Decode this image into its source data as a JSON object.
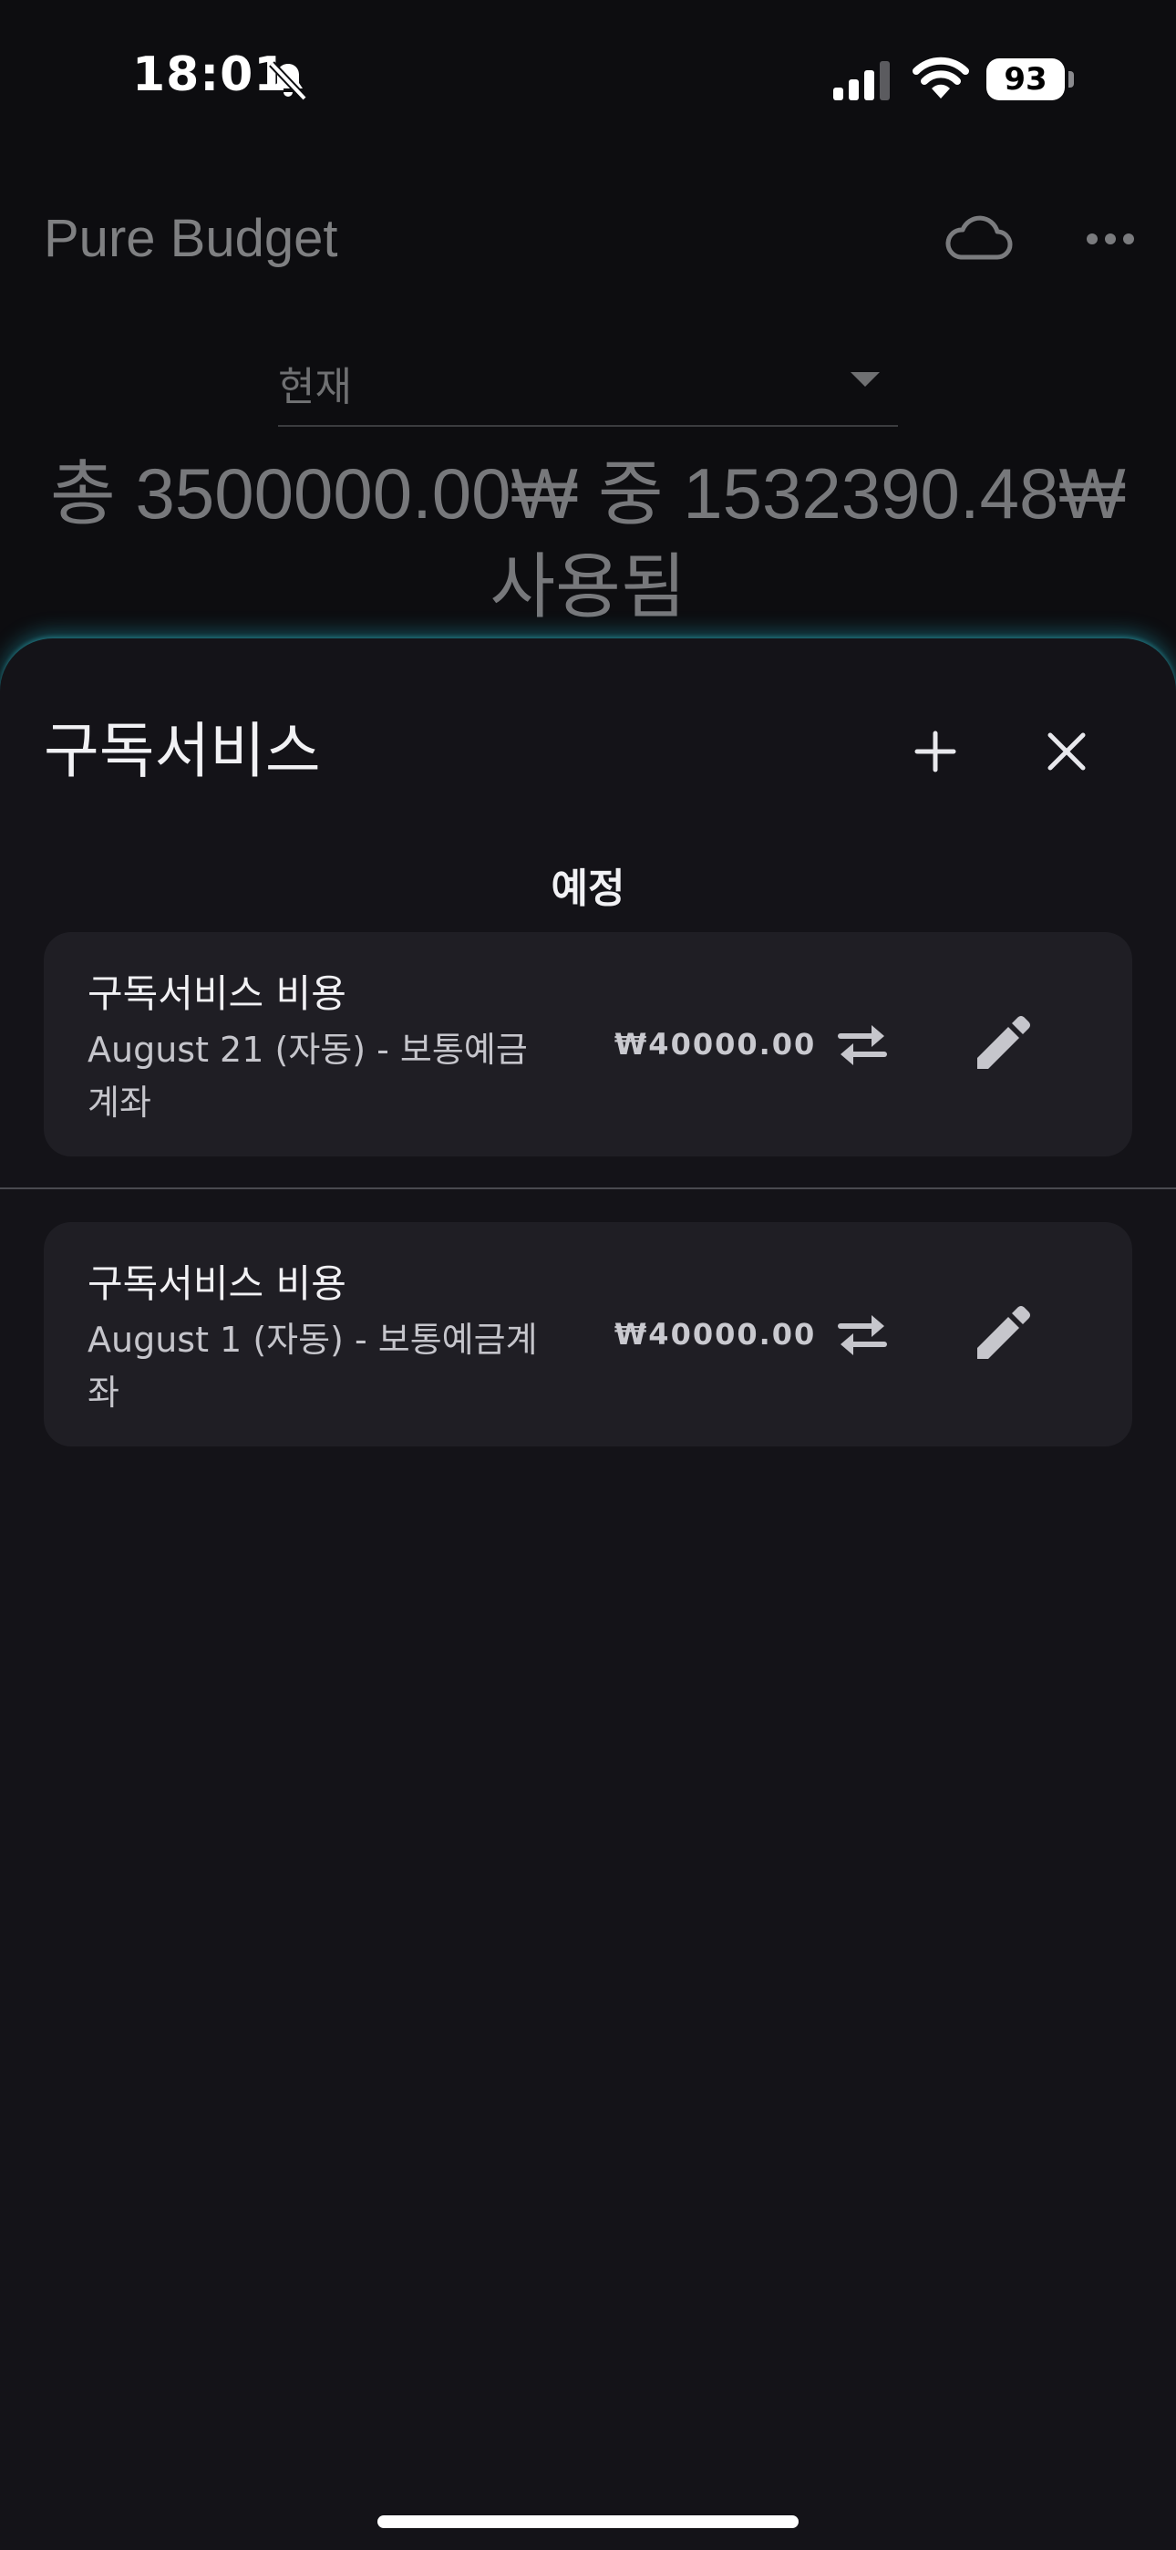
{
  "status_bar": {
    "time": "18:01",
    "battery": "93"
  },
  "header": {
    "app_title": "Pure Budget"
  },
  "period_select": {
    "value": "현재"
  },
  "summary": {
    "line1": "총 3500000.00₩ 중 1532390.48₩",
    "line2": "사용됨"
  },
  "sheet": {
    "title": "구독서비스",
    "section_label": "예정",
    "items": [
      {
        "title": "구독서비스 비용",
        "subtitle_line1": "August 21 (자동) - 보통예금",
        "subtitle_line2": "계좌",
        "amount": "₩40000.00"
      },
      {
        "title": "구독서비스 비용",
        "subtitle_line1": "August 1 (자동) - 보통예금계",
        "subtitle_line2": "좌",
        "amount": "₩40000.00"
      }
    ]
  },
  "colors": {
    "background": "#0d0d10",
    "sheet": "#141318",
    "card": "#1f1e24",
    "glow": "#22aabe"
  },
  "icons": [
    "bell-slash-icon",
    "signal-icon",
    "wifi-icon",
    "cloud-icon",
    "more-horizontal-icon",
    "dropdown-arrow-icon",
    "plus-icon",
    "close-icon",
    "swap-icon",
    "pencil-icon"
  ]
}
